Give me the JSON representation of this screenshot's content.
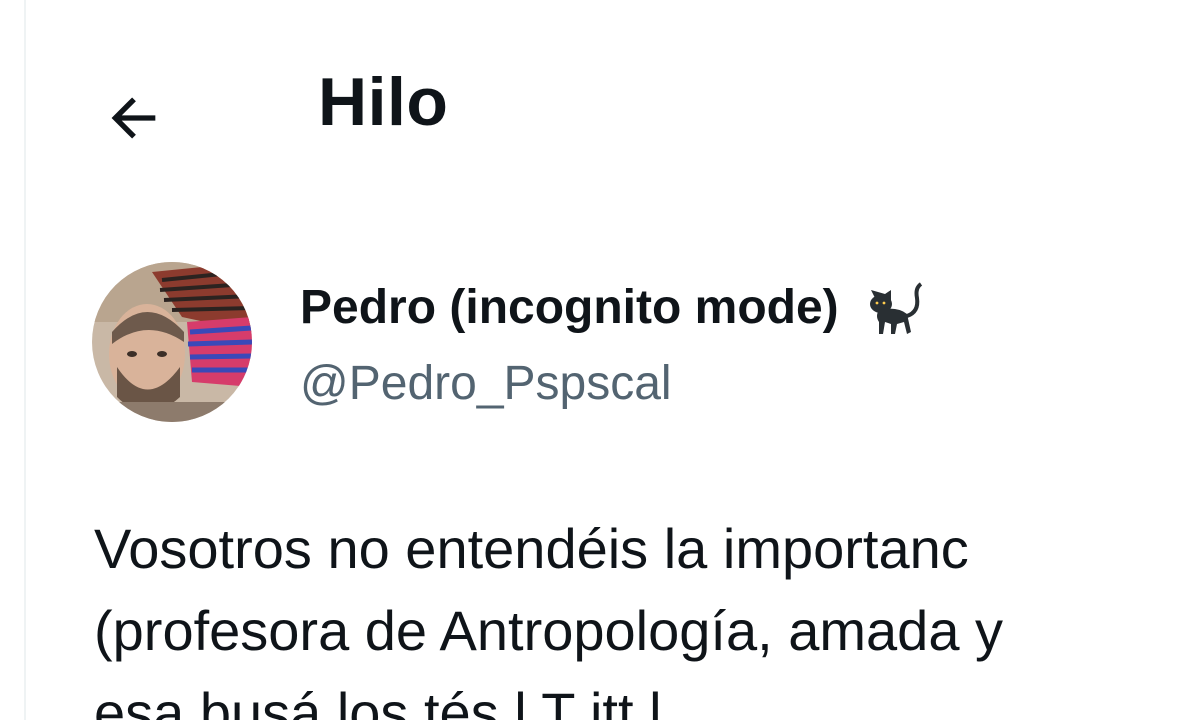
{
  "header": {
    "title": "Hilo",
    "back_icon": "arrow-left-icon"
  },
  "tweet": {
    "author": {
      "display_name": "Pedro (incognito mode)",
      "badge_icon": "black-cat-icon",
      "handle": "@Pedro_Pspscal"
    },
    "text_lines": [
      "Vosotros no entendéis la importanc",
      "(profesora de Antropología, amada y",
      "  esa busá  los tés  l    T itt    l"
    ]
  },
  "colors": {
    "text_primary": "#0f1419",
    "text_secondary": "#536471",
    "border": "#eff3f4",
    "background": "#ffffff"
  }
}
